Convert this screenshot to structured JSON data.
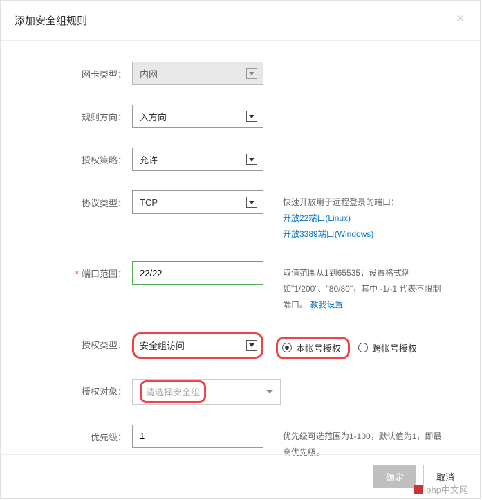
{
  "dialog": {
    "title": "添加安全组规则"
  },
  "form": {
    "nic_type": {
      "label": "网卡类型：",
      "value": "内网"
    },
    "rule_direction": {
      "label": "规则方向：",
      "value": "入方向"
    },
    "auth_policy": {
      "label": "授权策略：",
      "value": "允许"
    },
    "protocol_type": {
      "label": "协议类型：",
      "value": "TCP",
      "hint_title": "快速开放用于远程登录的端口：",
      "hint_link1": "开放22端口(Linux)",
      "hint_link2": "开放3389端口(Windows)"
    },
    "port_range": {
      "label": "端口范围：",
      "value": "22/22",
      "hint_text": "取值范围从1到65535；设置格式例如\"1/200\"、\"80/80\"，其中 -1/-1 代表不限制端口。",
      "hint_link": "教我设置"
    },
    "auth_type": {
      "label": "授权类型：",
      "value": "安全组访问",
      "radio1": "本帐号授权",
      "radio2": "跨帐号授权"
    },
    "auth_object": {
      "label": "授权对象：",
      "placeholder": "请选择安全组"
    },
    "priority": {
      "label": "优先级：",
      "value": "1",
      "hint": "优先级可选范围为1-100，默认值为1，即最高优先级。"
    }
  },
  "footer": {
    "confirm": "确定",
    "cancel": "取消"
  },
  "watermark": "php中文网"
}
